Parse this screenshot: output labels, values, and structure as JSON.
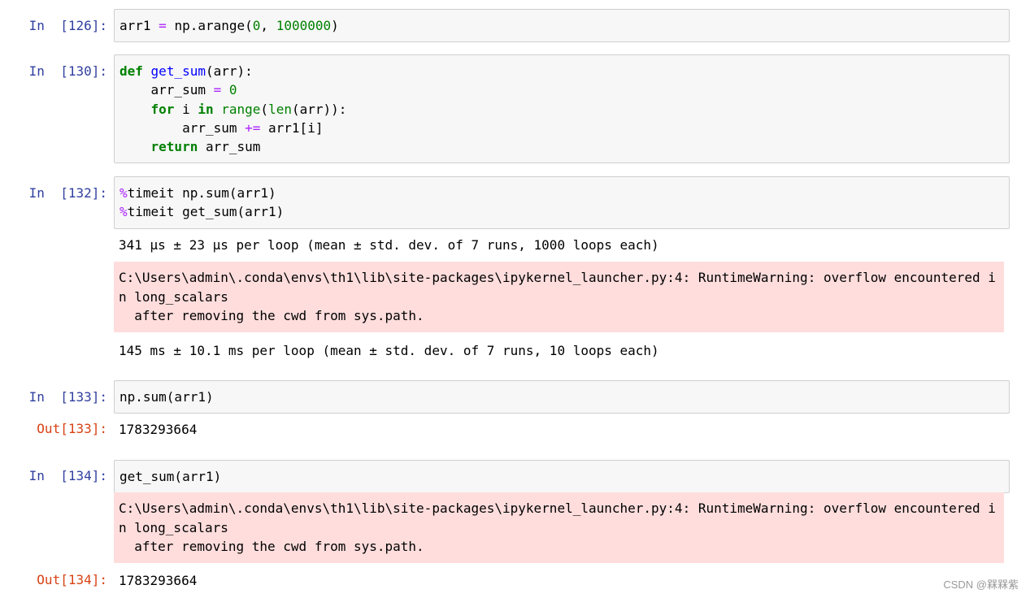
{
  "cells": {
    "c126": {
      "prompt": "In  [126]:",
      "lines": [
        [
          {
            "t": "arr1 "
          },
          {
            "t": "=",
            "c": "op"
          },
          {
            "t": " np.arange("
          },
          {
            "t": "0",
            "c": "num"
          },
          {
            "t": ", "
          },
          {
            "t": "1000000",
            "c": "num"
          },
          {
            "t": ")"
          }
        ]
      ]
    },
    "c130": {
      "prompt": "In  [130]:",
      "lines": [
        [
          {
            "t": "def",
            "c": "kw"
          },
          {
            "t": " "
          },
          {
            "t": "get_sum",
            "c": "fn"
          },
          {
            "t": "(arr):"
          }
        ],
        [
          {
            "t": "    arr_sum "
          },
          {
            "t": "=",
            "c": "op"
          },
          {
            "t": " "
          },
          {
            "t": "0",
            "c": "num"
          }
        ],
        [
          {
            "t": "    "
          },
          {
            "t": "for",
            "c": "kw"
          },
          {
            "t": " i "
          },
          {
            "t": "in",
            "c": "kw"
          },
          {
            "t": " "
          },
          {
            "t": "range",
            "c": "bi"
          },
          {
            "t": "("
          },
          {
            "t": "len",
            "c": "bi"
          },
          {
            "t": "(arr)):"
          }
        ],
        [
          {
            "t": "        arr_sum "
          },
          {
            "t": "+=",
            "c": "op"
          },
          {
            "t": " arr1[i]"
          }
        ],
        [
          {
            "t": "    "
          },
          {
            "t": "return",
            "c": "kw"
          },
          {
            "t": " arr_sum"
          }
        ]
      ]
    },
    "c132": {
      "prompt": "In  [132]:",
      "lines": [
        [
          {
            "t": "%",
            "c": "mg"
          },
          {
            "t": "timeit np.sum(arr1)"
          }
        ],
        [
          {
            "t": "%",
            "c": "mg"
          },
          {
            "t": "timeit get_sum(arr1)"
          }
        ]
      ],
      "stdout1": "341 µs ± 23 µs per loop (mean ± std. dev. of 7 runs, 1000 loops each)",
      "stderr": [
        "C:\\Users\\admin\\.conda\\envs\\th1\\lib\\site-packages\\ipykernel_launcher.py:4: RuntimeWarning: overflow encountered i",
        "n long_scalars",
        "  after removing the cwd from sys.path."
      ],
      "stdout2": "145 ms ± 10.1 ms per loop (mean ± std. dev. of 7 runs, 10 loops each)"
    },
    "c133": {
      "prompt": "In  [133]:",
      "lines": [
        [
          {
            "t": "np.sum(arr1)"
          }
        ]
      ],
      "out_prompt": "Out[133]:",
      "out": "1783293664"
    },
    "c134": {
      "prompt": "In  [134]:",
      "lines": [
        [
          {
            "t": "get_sum(arr1)"
          }
        ]
      ],
      "stderr": [
        "C:\\Users\\admin\\.conda\\envs\\th1\\lib\\site-packages\\ipykernel_launcher.py:4: RuntimeWarning: overflow encountered i",
        "n long_scalars",
        "  after removing the cwd from sys.path."
      ],
      "out_prompt": "Out[134]:",
      "out": "1783293664"
    }
  },
  "watermark": "CSDN @槑槑紫",
  "colors": {
    "prompt_in": "#303f9f",
    "prompt_out": "#d84315",
    "keyword": "#008000",
    "function_name": "#0000ff",
    "number": "#008000",
    "operator": "#aa22ff",
    "stderr_background": "#ffdddd",
    "input_background": "#f7f7f7"
  }
}
